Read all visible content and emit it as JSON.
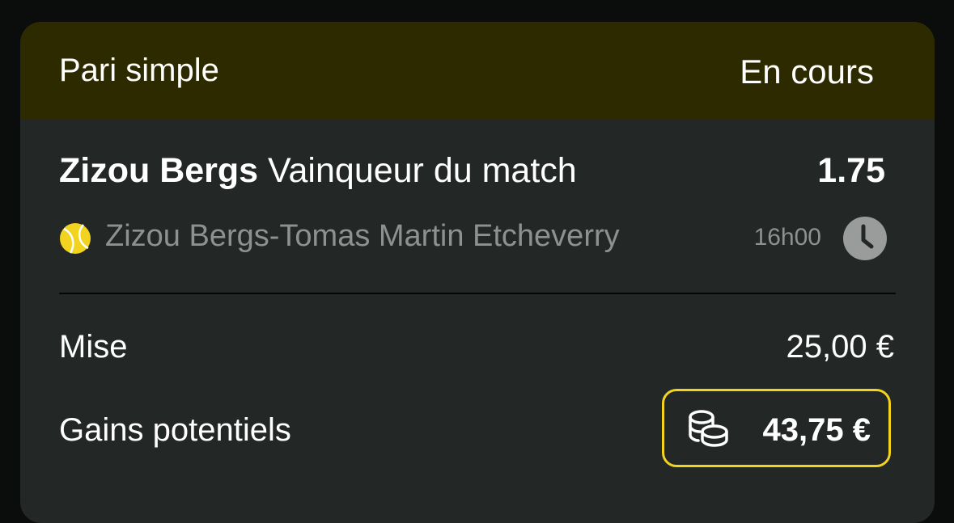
{
  "bet": {
    "type_label": "Pari simple",
    "status_label": "En cours"
  },
  "selection": {
    "player": "Zizou Bergs",
    "market": "Vainqueur du match",
    "odds": "1.75"
  },
  "event": {
    "sport_icon": "tennis-ball-icon",
    "match_name": "Zizou Bergs-Tomas Martin Etcheverry",
    "start_time": "16h00",
    "time_icon": "clock-icon"
  },
  "stake": {
    "label": "Mise",
    "value": "25,00 €"
  },
  "potential_gains": {
    "label": "Gains potentiels",
    "value": "43,75 €",
    "icon": "coins-icon"
  },
  "colors": {
    "header_bg": "#2e2a00",
    "card_bg": "#232725",
    "accent": "#f2d31f",
    "muted_text": "#8e918f"
  }
}
